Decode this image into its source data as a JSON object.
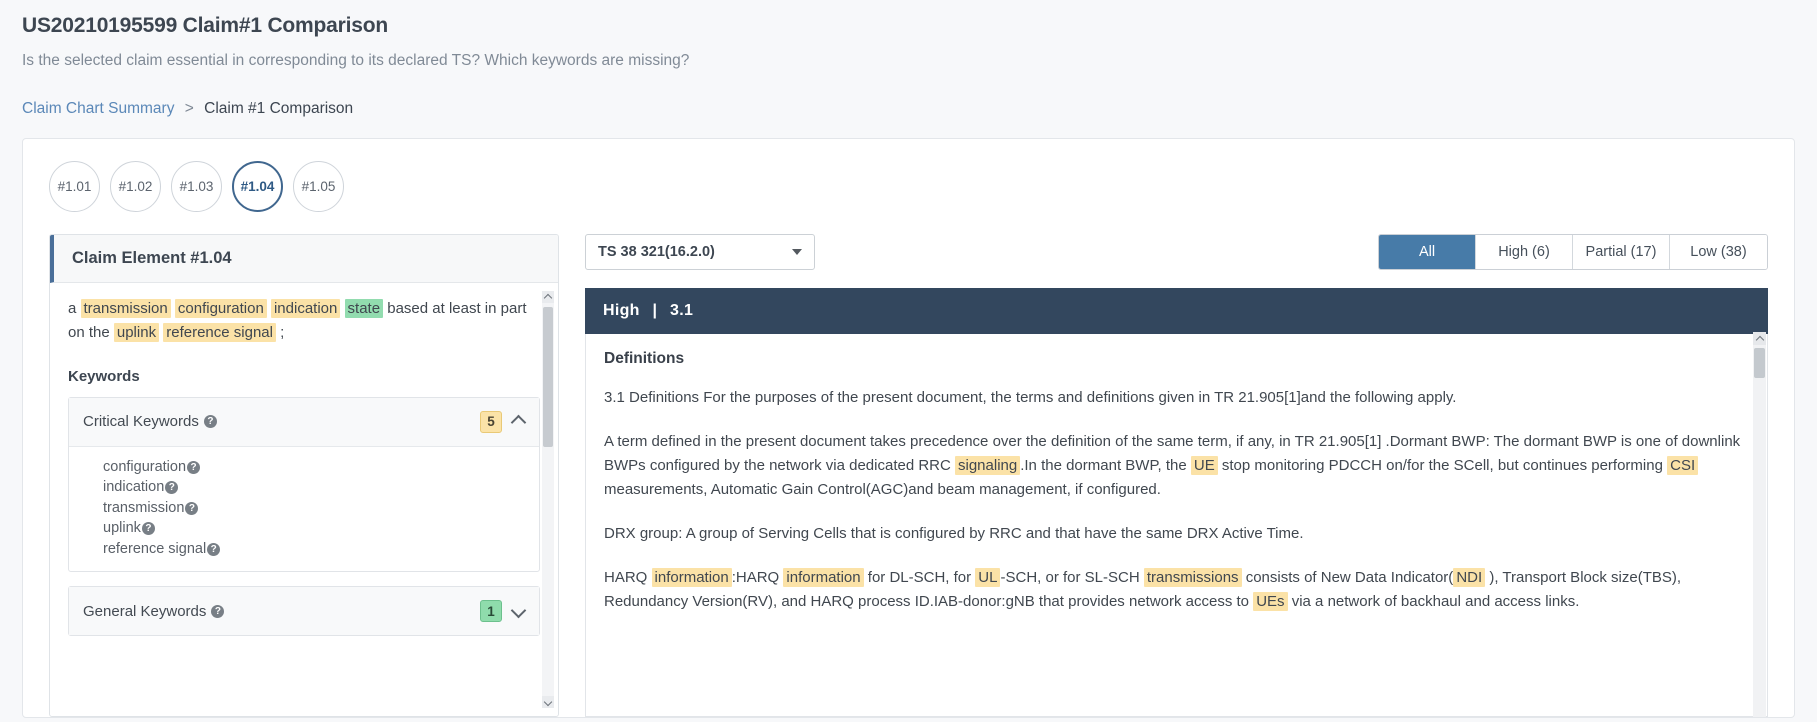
{
  "header": {
    "title": "US20210195599 Claim#1 Comparison",
    "subtitle": "Is the selected claim essential in corresponding to its declared TS? Which keywords are missing?",
    "breadcrumb": {
      "link": "Claim Chart Summary",
      "separator": ">",
      "current": "Claim #1 Comparison"
    }
  },
  "element_tabs": [
    {
      "label": "#1.01",
      "active": false
    },
    {
      "label": "#1.02",
      "active": false
    },
    {
      "label": "#1.03",
      "active": false
    },
    {
      "label": "#1.04",
      "active": true
    },
    {
      "label": "#1.05",
      "active": false
    }
  ],
  "claim_panel": {
    "heading": "Claim Element #1.04",
    "text_parts": [
      {
        "t": "a ",
        "h": "none"
      },
      {
        "t": "transmission",
        "h": "yellow"
      },
      {
        "t": " ",
        "h": "none"
      },
      {
        "t": "configuration",
        "h": "yellow"
      },
      {
        "t": " ",
        "h": "none"
      },
      {
        "t": "indication",
        "h": "yellow"
      },
      {
        "t": " ",
        "h": "none"
      },
      {
        "t": "state",
        "h": "green"
      },
      {
        "t": " based at least in part on the ",
        "h": "none"
      },
      {
        "t": "uplink",
        "h": "yellow"
      },
      {
        "t": " ",
        "h": "none"
      },
      {
        "t": "reference signal",
        "h": "yellow"
      },
      {
        "t": " ;",
        "h": "none"
      }
    ],
    "keywords_title": "Keywords",
    "accordions": [
      {
        "label": "Critical Keywords",
        "badge": "5",
        "badge_color": "#fbe3a8",
        "expanded": true,
        "chevron": "chevron-up",
        "items": [
          "configuration",
          "indication",
          "transmission",
          "uplink",
          "reference signal"
        ]
      },
      {
        "label": "General Keywords",
        "badge": "1",
        "badge_color": "#8fdcac",
        "expanded": false,
        "chevron": "chevron-down",
        "items": []
      }
    ]
  },
  "toolbar": {
    "ts_select_value": "TS 38 321(16.2.0)",
    "filters": [
      {
        "label": "All",
        "active": true
      },
      {
        "label": "High (6)",
        "active": false
      },
      {
        "label": "Partial (17)",
        "active": false
      },
      {
        "label": "Low (38)",
        "active": false
      }
    ]
  },
  "document": {
    "header_level": "High",
    "header_sep": "|",
    "header_section": "3.1",
    "heading": "Definitions",
    "paragraphs": [
      [
        {
          "t": "3.1 Definitions For the purposes of the present document, the terms and definitions given in TR 21.905[1]and the following apply.",
          "h": "none"
        }
      ],
      [
        {
          "t": "A term defined in the present document takes precedence over the definition of the same term, if any, in TR 21.905[1] .Dormant BWP: The dormant BWP is one of downlink BWPs configured by the network via dedicated RRC ",
          "h": "none"
        },
        {
          "t": "signaling",
          "h": "yellow"
        },
        {
          "t": ".In the dormant BWP, the ",
          "h": "none"
        },
        {
          "t": "UE",
          "h": "yellow"
        },
        {
          "t": " stop monitoring PDCCH on/for the SCell, but continues performing ",
          "h": "none"
        },
        {
          "t": "CSI",
          "h": "yellow"
        },
        {
          "t": " measurements, Automatic Gain Control(AGC)and beam management, if configured.",
          "h": "none"
        }
      ],
      [
        {
          "t": "DRX group: A group of Serving Cells that is configured by RRC and that have the same DRX Active Time.",
          "h": "none"
        }
      ],
      [
        {
          "t": "HARQ ",
          "h": "none"
        },
        {
          "t": "information",
          "h": "yellow"
        },
        {
          "t": ":HARQ ",
          "h": "none"
        },
        {
          "t": "information",
          "h": "yellow"
        },
        {
          "t": " for DL-SCH, for ",
          "h": "none"
        },
        {
          "t": "UL",
          "h": "yellow"
        },
        {
          "t": "-SCH, or for SL-SCH ",
          "h": "none"
        },
        {
          "t": "transmissions",
          "h": "yellow"
        },
        {
          "t": " consists of New Data Indicator(",
          "h": "none"
        },
        {
          "t": "NDI",
          "h": "yellow"
        },
        {
          "t": " ), Transport Block size(TBS), Redundancy Version(RV), and HARQ process ID.IAB-donor:gNB that provides network access to ",
          "h": "none"
        },
        {
          "t": "UEs",
          "h": "yellow"
        },
        {
          "t": " via a network of backhaul and access links.",
          "h": "none"
        }
      ]
    ]
  }
}
